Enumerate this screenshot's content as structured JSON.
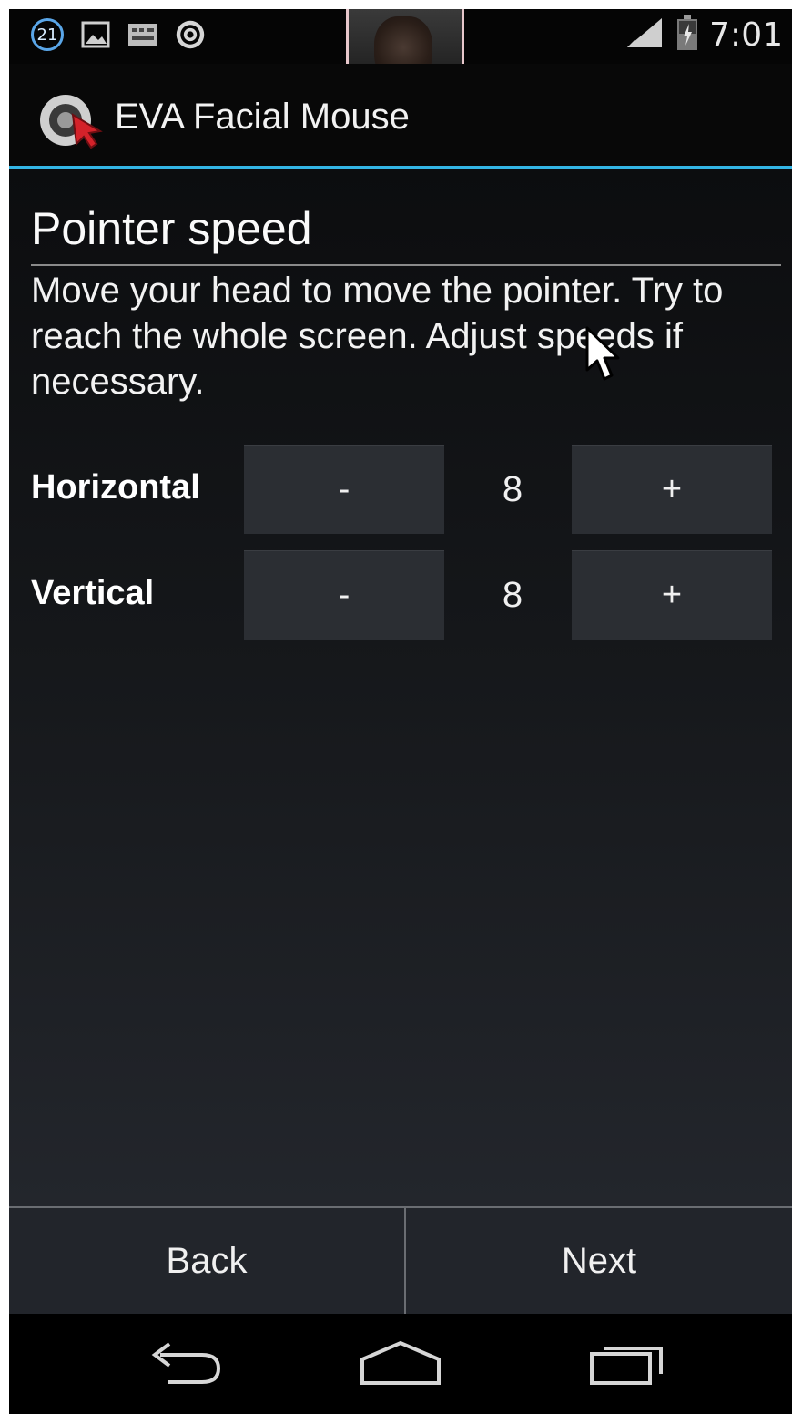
{
  "status_bar": {
    "notification_count": "21",
    "time": "7:01",
    "icons": [
      "notification-count-icon",
      "image-icon",
      "keyboard-icon",
      "target-icon",
      "camera-preview",
      "signal-icon",
      "battery-icon"
    ]
  },
  "action_bar": {
    "app_title": "EVA Facial Mouse",
    "logo_icon": "eva-logo-icon"
  },
  "page": {
    "title": "Pointer speed",
    "instructions": "Move your head to move the pointer. Try to reach the whole screen. Adjust speeds if necessary."
  },
  "speed_controls": [
    {
      "label": "Horizontal",
      "decrease_label": "-",
      "value": "8",
      "increase_label": "+"
    },
    {
      "label": "Vertical",
      "decrease_label": "-",
      "value": "8",
      "increase_label": "+"
    }
  ],
  "footer": {
    "back_label": "Back",
    "next_label": "Next"
  },
  "navigation": {
    "icons": [
      "back-icon",
      "home-icon",
      "recent-apps-icon"
    ]
  },
  "colors": {
    "accent": "#33b5e5",
    "button_bg": "#2b2e33",
    "text": "#f0f0f0"
  }
}
